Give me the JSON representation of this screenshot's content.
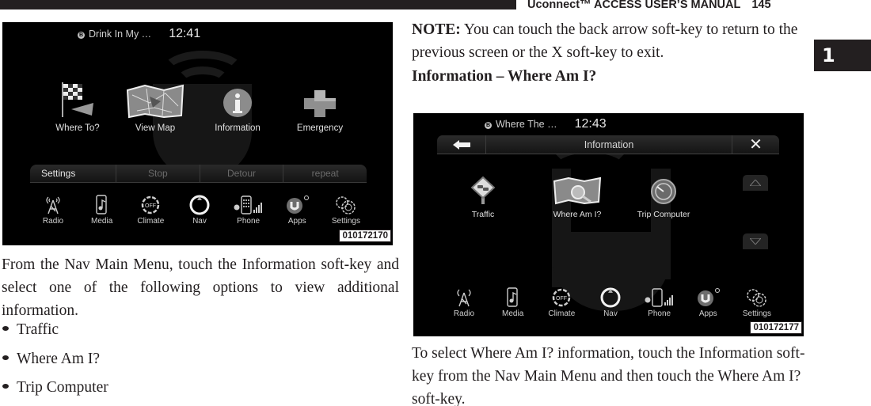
{
  "header": {
    "title": "Uconnect™ ACCESS USER’S MANUAL",
    "page_number": "145"
  },
  "chapter_tab": "1",
  "screen_main_menu": {
    "status": {
      "now_playing": "Drink In My …",
      "clock": "12:41"
    },
    "apps": [
      {
        "label": "Where To?",
        "icon": "checkered-flag-icon"
      },
      {
        "label": "View Map",
        "icon": "map-icon"
      },
      {
        "label": "Information",
        "icon": "info-icon"
      },
      {
        "label": "Emergency",
        "icon": "emergency-cross-icon"
      }
    ],
    "softkeys": [
      "Settings",
      "Stop",
      "Detour",
      "repeat"
    ],
    "dock": [
      {
        "label": "Radio",
        "icon": "radio-tower-icon"
      },
      {
        "label": "Media",
        "icon": "media-phone-icon"
      },
      {
        "label": "Climate",
        "icon": "climate-off-icon"
      },
      {
        "label": "Nav",
        "icon": "nav-compass-icon"
      },
      {
        "label": "Phone",
        "icon": "phone-keypad-icon"
      },
      {
        "label": "Apps",
        "icon": "uconnect-apps-icon"
      },
      {
        "label": "Settings",
        "icon": "settings-gears-icon"
      }
    ],
    "figure_id": "010172170"
  },
  "screen_information": {
    "status": {
      "now_playing": "Where The …",
      "clock": "12:43"
    },
    "title": "Information",
    "back_icon": "back-arrow-icon",
    "close_icon": "close-x-icon",
    "apps": [
      {
        "label": "Traffic",
        "icon": "traffic-sign-icon"
      },
      {
        "label": "Where Am I?",
        "icon": "map-magnifier-icon"
      },
      {
        "label": "Trip Computer",
        "icon": "trip-computer-gauge-icon"
      }
    ],
    "dock": [
      {
        "label": "Radio"
      },
      {
        "label": "Media"
      },
      {
        "label": "Climate"
      },
      {
        "label": "Nav"
      },
      {
        "label": "Phone"
      },
      {
        "label": "Apps"
      },
      {
        "label": "Settings"
      }
    ],
    "figure_id": "010172177"
  },
  "left_column": {
    "intro": "From the Nav Main Menu, touch the Information soft-key and select one of the following options to view additional information.",
    "bullets": [
      "Traffic",
      "Where Am I?",
      "Trip Computer"
    ]
  },
  "right_column": {
    "note_label": "NOTE:",
    "note_text": "You can touch the back arrow soft-key to return to the previous screen or the X soft-key to exit.",
    "heading": "Information – Where Am I?",
    "body": "To select Where Am I? information, touch the Information soft-key from the Nav Main Menu and then touch the Where Am I? soft-key."
  }
}
